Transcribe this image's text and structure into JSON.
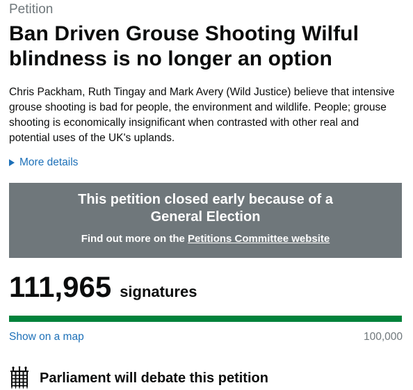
{
  "petition": {
    "kicker": "Petition",
    "title": "Ban Driven Grouse Shooting Wilful blindness is no longer an option",
    "description": "Chris Packham, Ruth Tingay and Mark Avery (Wild Justice) believe that intensive grouse shooting is bad for people, the environment and wildlife. People; grouse shooting is economically insignificant when contrasted with other real and potential uses of the UK's uplands.",
    "more_details_label": "More details"
  },
  "status_banner": {
    "headline": "This petition closed early because of a General Election",
    "sub_prefix": "Find out more on the ",
    "sub_link": "Petitions Committee website"
  },
  "signatures": {
    "count": "111,965",
    "label": "signatures",
    "progress_fraction": 1.0,
    "map_link": "Show on a map",
    "target": "100,000"
  },
  "debate": {
    "icon": "portcullis-icon",
    "heading": "Parliament will debate this petition"
  },
  "colors": {
    "link": "#1d70b8",
    "banner_bg": "#6f777b",
    "progress_fill": "#00823b",
    "progress_track": "#dee0e2",
    "text": "#0b0c0c",
    "muted": "#6f777b"
  }
}
